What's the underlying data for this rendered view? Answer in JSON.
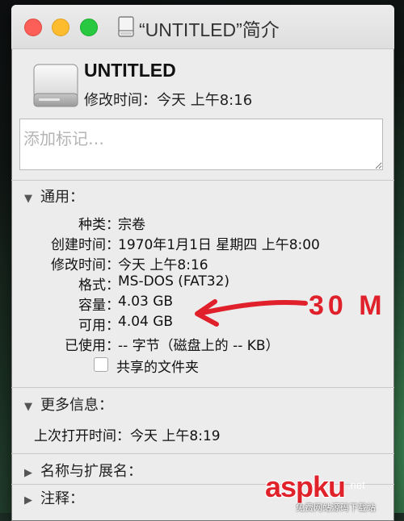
{
  "window": {
    "title": "“UNTITLED”简介"
  },
  "header": {
    "disk_name": "UNTITLED",
    "modified": "修改时间：今天 上午8:16"
  },
  "tags": {
    "placeholder": "添加标记…"
  },
  "general": {
    "heading": "通用：",
    "rows": [
      {
        "label": "种类：",
        "value": "宗卷"
      },
      {
        "label": "创建时间：",
        "value": "1970年1月1日 星期四 上午8:00"
      },
      {
        "label": "修改时间：",
        "value": "今天 上午8:16"
      },
      {
        "label": "格式：",
        "value": "MS-DOS (FAT32)"
      },
      {
        "label": "容量：",
        "value": "4.03 GB"
      },
      {
        "label": "可用：",
        "value": "4.04 GB"
      },
      {
        "label": "已使用：",
        "value": "-- 字节（磁盘上的 -- KB）"
      }
    ],
    "shared_label": "共享的文件夹"
  },
  "more_info": {
    "heading": "更多信息：",
    "last_opened": "上次打开时间：今天 上午8:19"
  },
  "name_ext": {
    "heading": "名称与扩展名："
  },
  "comments": {
    "heading": "注释："
  },
  "annotation": {
    "text": "30 M",
    "color": "#e0202a"
  },
  "watermark": {
    "brand": "aspku",
    "suffix": ".net",
    "caption": "免费网站源码下载站"
  },
  "icons": [
    "drive-icon",
    "disclosure-triangle-icon",
    "arrow-annotation-icon"
  ]
}
